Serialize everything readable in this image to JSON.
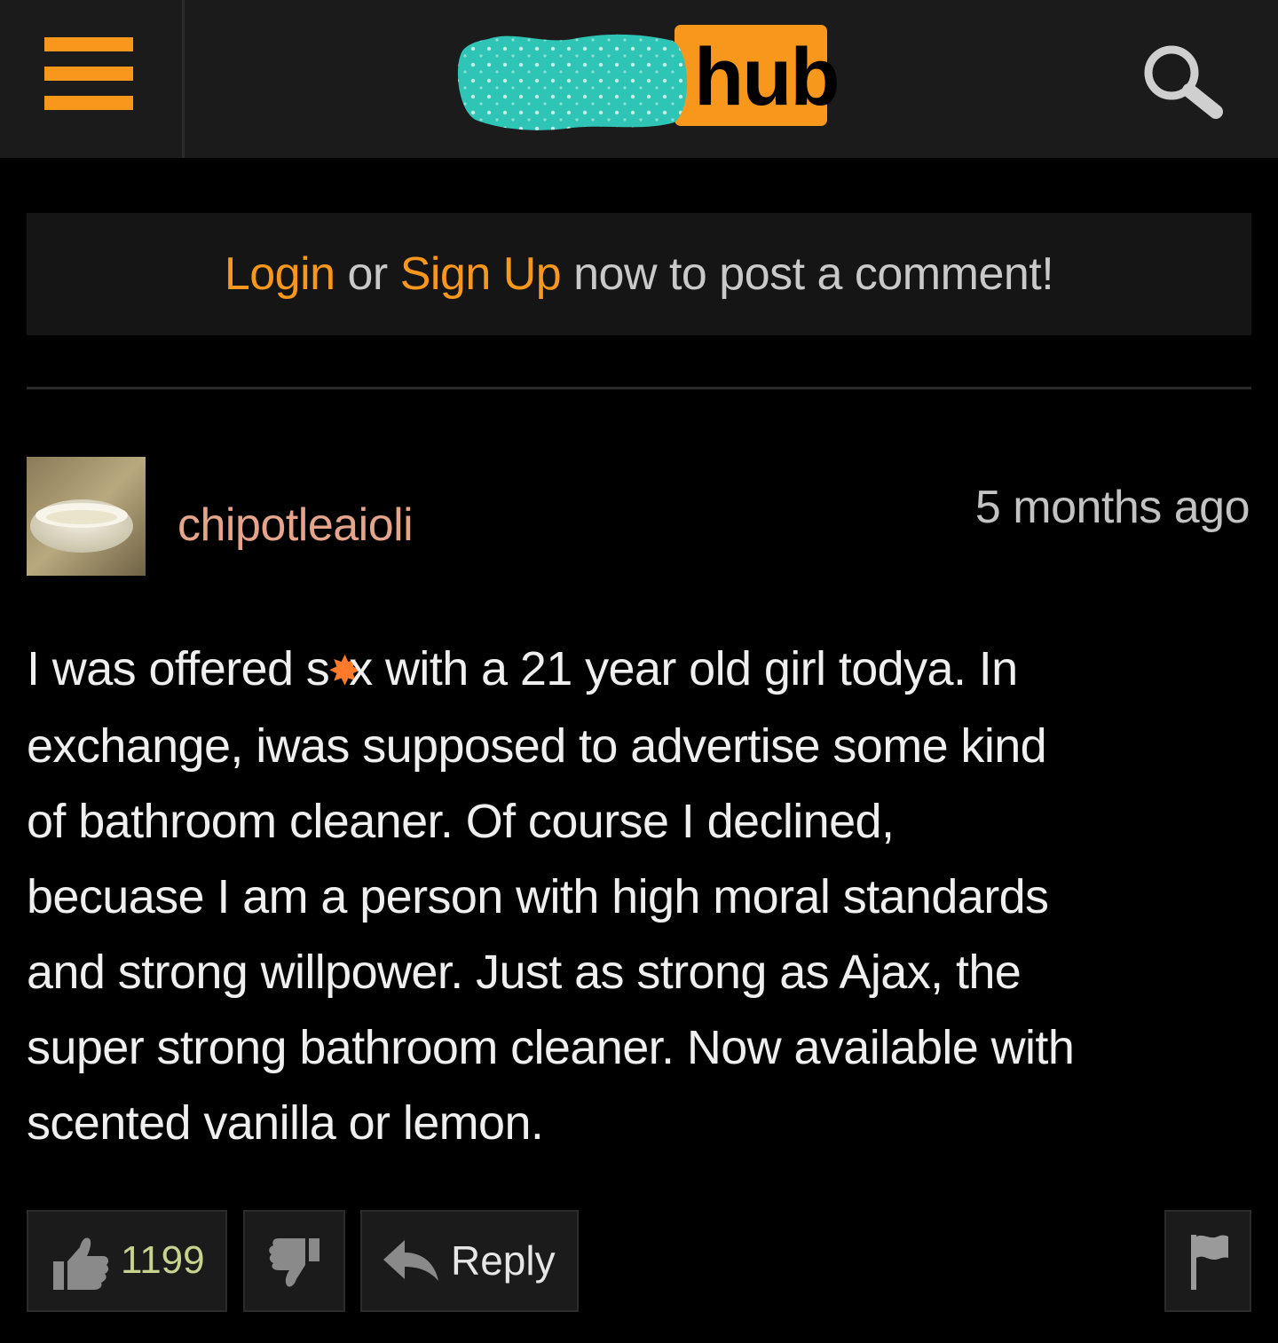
{
  "header": {
    "logo_text": "hub",
    "colors": {
      "accent": "#f7971c",
      "background": "#1b1b1b",
      "redaction": "#2ec4b6"
    }
  },
  "login_banner": {
    "login": "Login",
    "or": " or ",
    "signup": "Sign Up",
    "rest": " now to post a comment!"
  },
  "comment": {
    "username": "chipotleaioli",
    "timestamp": "5 months ago",
    "lines": {
      "l1a": "I was offered s",
      "l1star": "✸",
      "l1b": "x with a 21 year old girl todya. In",
      "l2": "exchange, iwas supposed to advertise some kind",
      "l3": "of bathroom cleaner. Of course I declined,",
      "l4": "becuase I am a person with high moral standards",
      "l5": "and strong willpower. Just as strong as Ajax, the",
      "l6": "super strong bathroom cleaner. Now available with",
      "l7": "scented vanilla or lemon."
    }
  },
  "actions": {
    "like_count": "1199",
    "reply_label": "Reply"
  },
  "icons": [
    "menu-icon",
    "search-icon",
    "thumbs-up-icon",
    "thumbs-down-icon",
    "reply-arrow-icon",
    "flag-icon"
  ]
}
